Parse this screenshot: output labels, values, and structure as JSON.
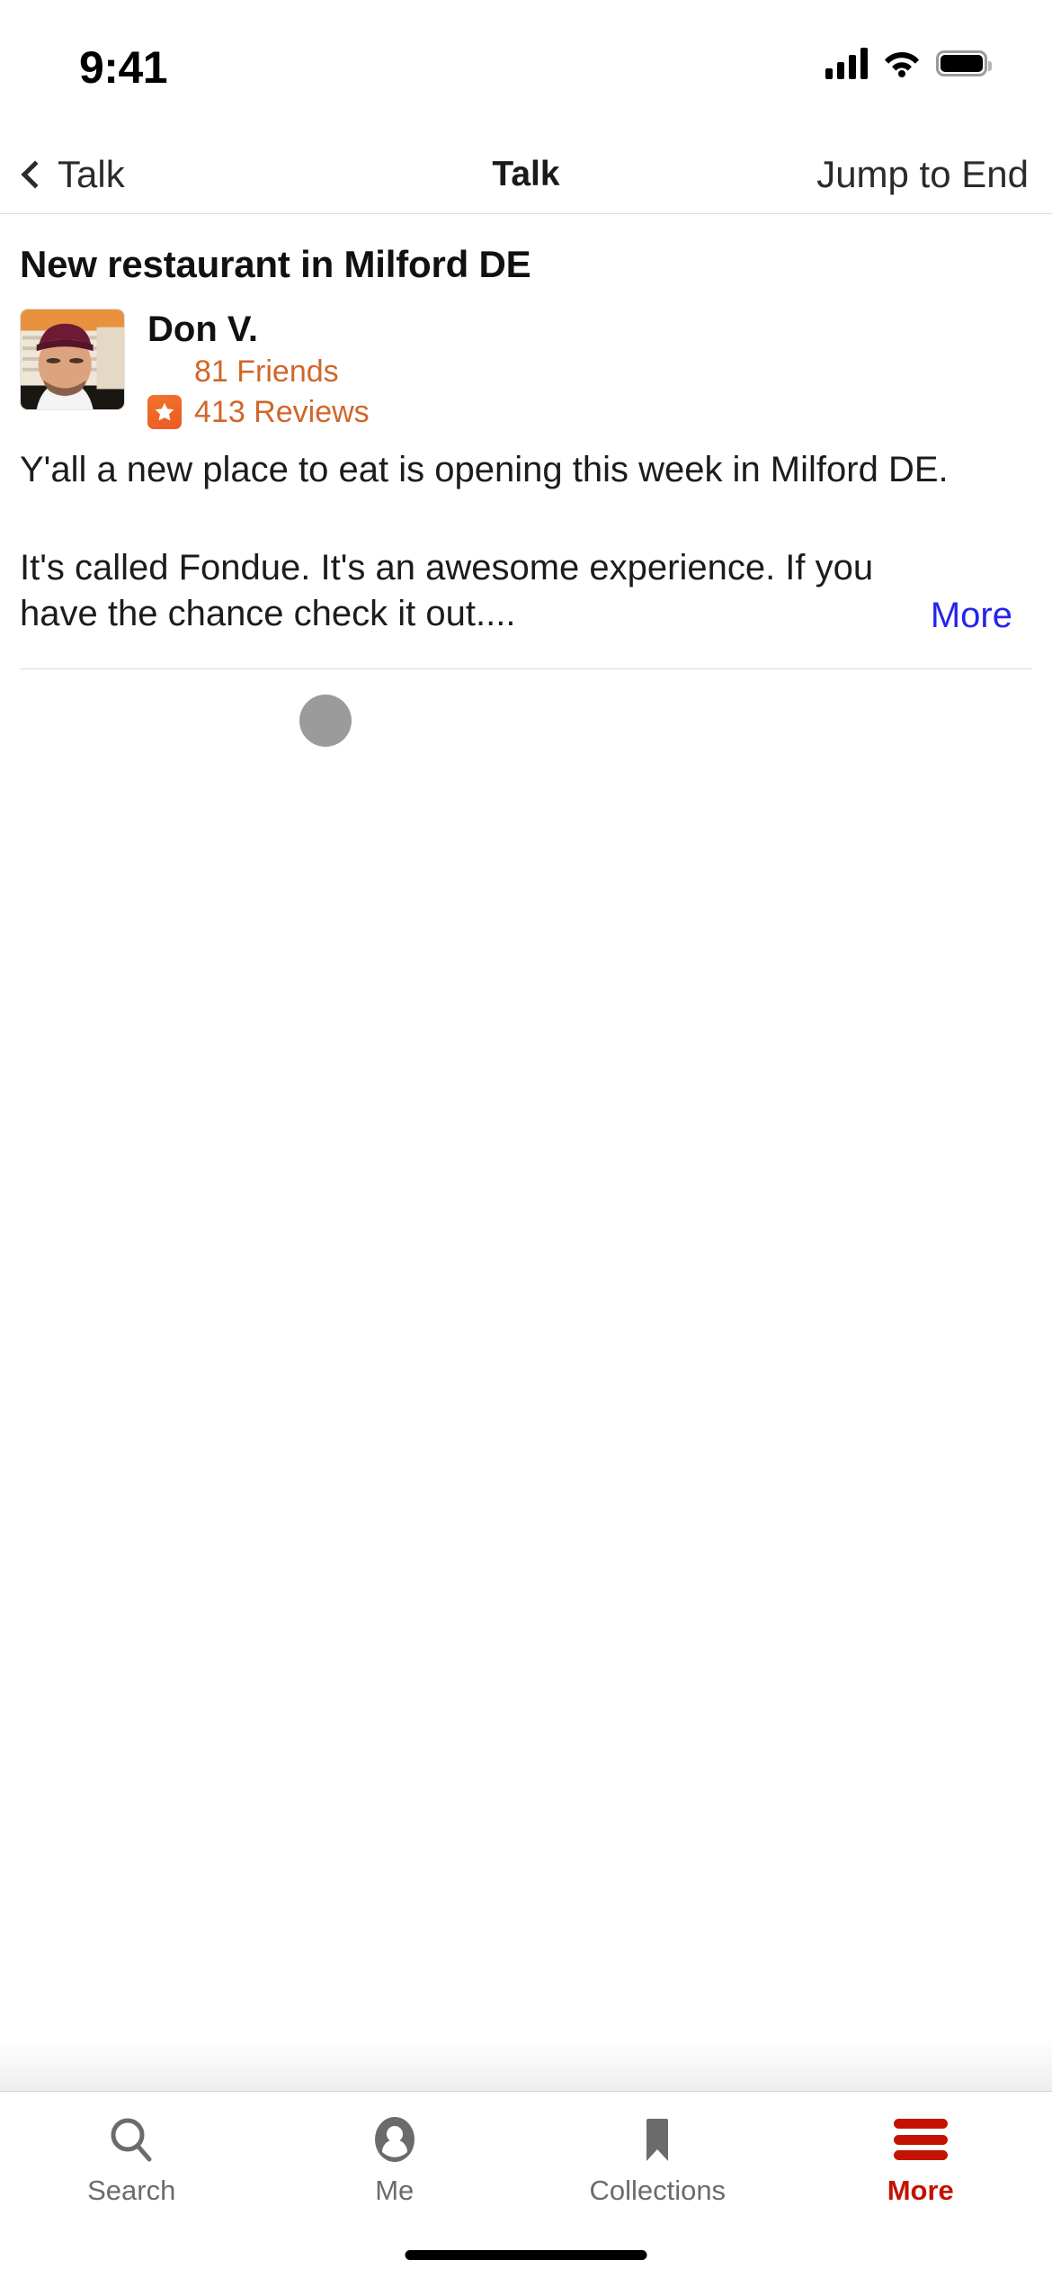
{
  "status_bar": {
    "time": "9:41",
    "cellular_icon": "cellular-signal-icon",
    "wifi_icon": "wifi-icon",
    "battery_icon": "battery-full-icon"
  },
  "nav_bar": {
    "back_icon": "chevron-left-icon",
    "back_label": "Talk",
    "title": "Talk",
    "right_action": "Jump to End"
  },
  "post": {
    "title": "New restaurant in Milford DE",
    "author": {
      "avatar_alt": "avatar",
      "name": "Don V.",
      "friends_icon": "friends-icon",
      "friends": "81 Friends",
      "reviews_icon": "review-star-badge-icon",
      "reviews": "413 Reviews"
    },
    "paragraph_1": "Y'all a new place to eat is opening this week in Milford DE.",
    "paragraph_2": "It's called Fondue. It's an awesome experience. If you have the chance check it out....",
    "more_label": "More"
  },
  "loading": {
    "spinner_icon": "loading-spinner-dot"
  },
  "tab_bar": {
    "items": [
      {
        "label": "Search",
        "icon": "search-icon",
        "active": false
      },
      {
        "label": "Me",
        "icon": "user-circle-icon",
        "active": false
      },
      {
        "label": "Collections",
        "icon": "bookmark-icon",
        "active": false
      },
      {
        "label": "More",
        "icon": "hamburger-menu-icon",
        "active": true
      }
    ]
  },
  "colors": {
    "accent_orange": "#d1662a",
    "badge_orange": "#EC5A23",
    "link_blue": "#2525ec",
    "active_red": "#C41200",
    "spinner_gray": "#9b9b9b"
  }
}
